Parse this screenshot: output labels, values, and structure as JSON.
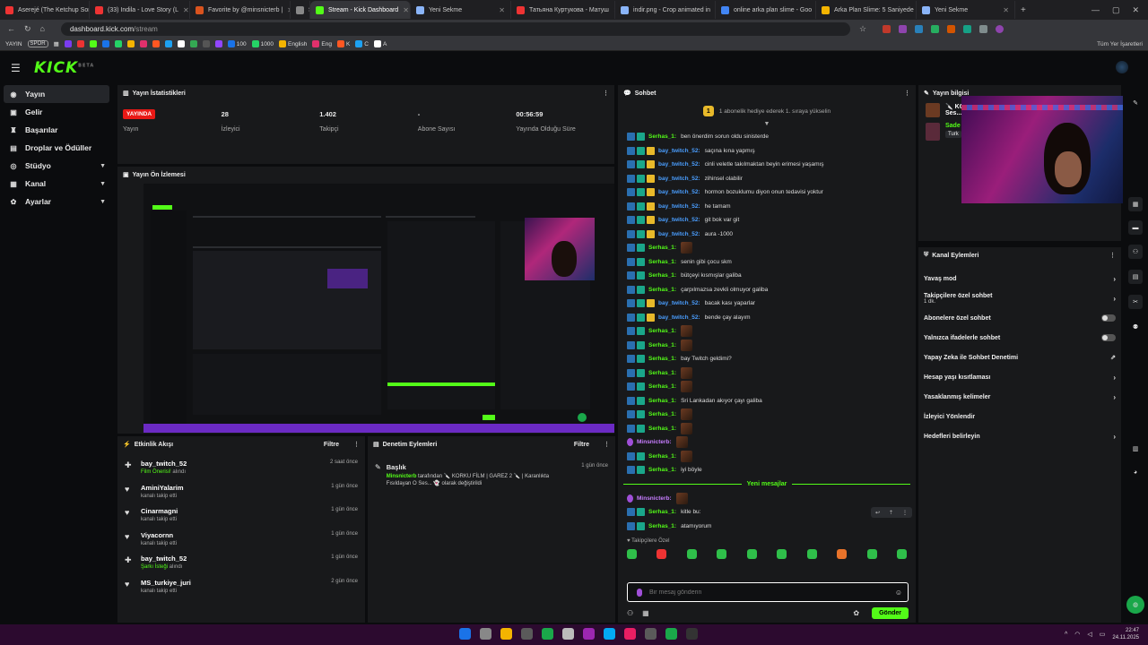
{
  "browser": {
    "tabs": [
      {
        "label": "Aserejé (The Ketchup Song)",
        "color": "#e33"
      },
      {
        "label": "(33) Indila - Love Story (L",
        "color": "#e33"
      },
      {
        "label": "Favorite by @minsnicterb |",
        "color": "#d9531e"
      },
      {
        "label": "SPOR",
        "color": "#888"
      },
      {
        "label": "Stream - Kick Dashboard",
        "color": "#53fc18"
      },
      {
        "label": "Yeni Sekme",
        "color": "#8ab4f8"
      },
      {
        "label": "Татьяна Куртукова - Матуш",
        "color": "#e33"
      },
      {
        "label": "indir.png - Crop animated in",
        "color": "#8ab4f8"
      },
      {
        "label": "online arka plan slime - Goo",
        "color": "#4285f4"
      },
      {
        "label": "Arka Plan Slime: 5 Saniyede",
        "color": "#f4b400"
      },
      {
        "label": "Yeni Sekme",
        "color": "#8ab4f8"
      }
    ],
    "url_host": "dashboard.kick.com",
    "url_path": "/stream",
    "bookmarks_left": [
      "YAYIN",
      "SPOR"
    ],
    "bookmarks_mid": [
      "100",
      "1000",
      "English",
      "Eng",
      "K",
      "C",
      "A"
    ],
    "bookmarks_right": "Tüm Yer İşaretleri"
  },
  "app": {
    "logo": "KICK",
    "logo_sup": "BETA"
  },
  "sidebar": {
    "items": [
      {
        "label": "Yayın",
        "icon": "broadcast-icon",
        "glyph": "◉"
      },
      {
        "label": "Gelir",
        "icon": "wallet-icon",
        "glyph": "▣"
      },
      {
        "label": "Başarılar",
        "icon": "trophy-icon",
        "glyph": "♜"
      },
      {
        "label": "Droplar ve Ödüller",
        "icon": "gift-icon",
        "glyph": "▤"
      },
      {
        "label": "Stüdyo",
        "icon": "studio-icon",
        "glyph": "◎"
      },
      {
        "label": "Kanal",
        "icon": "channel-icon",
        "glyph": "▦"
      },
      {
        "label": "Ayarlar",
        "icon": "gear-icon",
        "glyph": "✿"
      }
    ]
  },
  "stats_panel": {
    "title": "Yayın İstatistikleri",
    "live_badge": "YAYINDA",
    "stats": [
      {
        "value": "",
        "label": "Yayın"
      },
      {
        "value": "28",
        "label": "İzleyici"
      },
      {
        "value": "1.402",
        "label": "Takipçi"
      },
      {
        "value": "-",
        "label": "Abone Sayısı"
      },
      {
        "value": "00:56:59",
        "label": "Yayında Olduğu Süre"
      }
    ]
  },
  "preview_panel": {
    "title": "Yayın Ön İzlemesi"
  },
  "activity_panel": {
    "title": "Etkinlik Akışı",
    "filter": "Filtre",
    "items": [
      {
        "name": "bay_twitch_52",
        "highlight": "Film Önerisi!",
        "desc": " alındı",
        "time": "2 saat önce",
        "icon": "gift-icon",
        "glyph": "✚"
      },
      {
        "name": "AminiYalarim",
        "highlight": "",
        "desc": "kanalı takip etti",
        "time": "1 gün önce",
        "icon": "heart-icon",
        "glyph": "♥"
      },
      {
        "name": "Cinarmagni",
        "highlight": "",
        "desc": "kanalı takip etti",
        "time": "1 gün önce",
        "icon": "heart-icon",
        "glyph": "♥"
      },
      {
        "name": "Viyacornn",
        "highlight": "",
        "desc": "kanalı takip etti",
        "time": "1 gün önce",
        "icon": "heart-icon",
        "glyph": "♥"
      },
      {
        "name": "bay_twitch_52",
        "highlight": "Şarkı İsteği",
        "desc": " alındı",
        "time": "1 gün önce",
        "icon": "gift-icon",
        "glyph": "✚"
      },
      {
        "name": "MS_turkiye_juri",
        "highlight": "",
        "desc": "kanalı takip etti",
        "time": "2 gün önce",
        "icon": "heart-icon",
        "glyph": "♥"
      }
    ]
  },
  "mod_panel": {
    "title": "Denetim Eylemleri",
    "filter": "Filtre",
    "items": [
      {
        "name": "Başlık",
        "actor": "Minsnicterb",
        "desc": " tarafından 🔪 KORKU FİLM | GAREZ 2 🔪 | Karanlıkta Fısıldayan O Ses... 👻 olarak değiştirildi",
        "time": "1 gün önce"
      }
    ]
  },
  "chat_panel": {
    "title": "Sohbet",
    "sub_banner": "1 abonelik hediye ederek 1. sıraya yükselin",
    "messages": [
      {
        "user": "Serhas_1:",
        "color": "green",
        "badges": [
          "blue",
          "teal"
        ],
        "text": "ben önerdim sorun oldu sinisterde",
        "emote": false
      },
      {
        "user": "bay_twitch_52:",
        "color": "blue",
        "badges": [
          "blue",
          "teal",
          "crown"
        ],
        "text": "saçına kına yapmış",
        "emote": false
      },
      {
        "user": "bay_twitch_52:",
        "color": "blue",
        "badges": [
          "blue",
          "teal",
          "crown"
        ],
        "text": "cinli veletle takılmaktan beyin erimesi yaşamış",
        "emote": false
      },
      {
        "user": "bay_twitch_52:",
        "color": "blue",
        "badges": [
          "blue",
          "teal",
          "crown"
        ],
        "text": "zihinsel olabilir",
        "emote": false
      },
      {
        "user": "bay_twitch_52:",
        "color": "blue",
        "badges": [
          "blue",
          "teal",
          "crown"
        ],
        "text": "hormon bozuklumu diyon onun tedavisi yoktur",
        "emote": false
      },
      {
        "user": "bay_twitch_52:",
        "color": "blue",
        "badges": [
          "blue",
          "teal",
          "crown"
        ],
        "text": "he tamam",
        "emote": false
      },
      {
        "user": "bay_twitch_52:",
        "color": "blue",
        "badges": [
          "blue",
          "teal",
          "crown"
        ],
        "text": "git bok var git",
        "emote": false
      },
      {
        "user": "bay_twitch_52:",
        "color": "blue",
        "badges": [
          "blue",
          "teal",
          "crown"
        ],
        "text": "aura -1000",
        "emote": false
      },
      {
        "user": "Serhas_1:",
        "color": "green",
        "badges": [
          "blue",
          "teal"
        ],
        "text": "",
        "emote": true
      },
      {
        "user": "Serhas_1:",
        "color": "green",
        "badges": [
          "blue",
          "teal"
        ],
        "text": "senin gibi çocu skm",
        "emote": false
      },
      {
        "user": "Serhas_1:",
        "color": "green",
        "badges": [
          "blue",
          "teal"
        ],
        "text": "bütçeyi kısmışlar galiba",
        "emote": false
      },
      {
        "user": "Serhas_1:",
        "color": "green",
        "badges": [
          "blue",
          "teal"
        ],
        "text": "çarpılmazsa zevkli olmuyor galiba",
        "emote": false
      },
      {
        "user": "bay_twitch_52:",
        "color": "blue",
        "badges": [
          "blue",
          "teal",
          "crown"
        ],
        "text": "bacak kası yaparlar",
        "emote": false
      },
      {
        "user": "bay_twitch_52:",
        "color": "blue",
        "badges": [
          "blue",
          "teal",
          "crown"
        ],
        "text": "bende çay alayım",
        "emote": false
      },
      {
        "user": "Serhas_1:",
        "color": "green",
        "badges": [
          "blue",
          "teal"
        ],
        "text": "",
        "emote": true
      },
      {
        "user": "Serhas_1:",
        "color": "green",
        "badges": [
          "blue",
          "teal"
        ],
        "text": "",
        "emote": true
      },
      {
        "user": "Serhas_1:",
        "color": "green",
        "badges": [
          "blue",
          "teal"
        ],
        "text": "bay Twitch geldimi?",
        "emote": false
      },
      {
        "user": "Serhas_1:",
        "color": "green",
        "badges": [
          "blue",
          "teal"
        ],
        "text": "",
        "emote": true
      },
      {
        "user": "Serhas_1:",
        "color": "green",
        "badges": [
          "blue",
          "teal"
        ],
        "text": "",
        "emote": true
      },
      {
        "user": "Serhas_1:",
        "color": "green",
        "badges": [
          "blue",
          "teal"
        ],
        "text": "Sri Lankadan akıyor çayı galiba",
        "emote": false
      },
      {
        "user": "Serhas_1:",
        "color": "green",
        "badges": [
          "blue",
          "teal"
        ],
        "text": "",
        "emote": true
      },
      {
        "user": "Serhas_1:",
        "color": "green",
        "badges": [
          "blue",
          "teal"
        ],
        "text": "",
        "emote": true
      },
      {
        "user": "Minsnicterb:",
        "color": "purple",
        "badges": [
          "mic"
        ],
        "text": "",
        "emote": true
      },
      {
        "user": "Serhas_1:",
        "color": "green",
        "badges": [
          "blue",
          "teal"
        ],
        "text": "",
        "emote": true
      },
      {
        "user": "Serhas_1:",
        "color": "green",
        "badges": [
          "blue",
          "teal"
        ],
        "text": "iyi böyle",
        "emote": false
      }
    ],
    "new_messages_label": "Yeni mesajlar",
    "new_messages": [
      {
        "user": "Minsnicterb:",
        "color": "purple",
        "badges": [
          "mic"
        ],
        "text": "",
        "emote": true
      },
      {
        "user": "Serhas_1:",
        "color": "green",
        "badges": [
          "blue",
          "teal"
        ],
        "text": "kitle bu:",
        "emote": false
      },
      {
        "user": "Serhas_1:",
        "color": "green",
        "badges": [
          "blue",
          "teal"
        ],
        "text": "atamıyorum",
        "emote": false
      }
    ],
    "emote_label": "♥ Takipçilere Özel",
    "input_placeholder": "Bir mesaj gönderin",
    "send_label": "Gönder"
  },
  "info_panel": {
    "title": "Yayın bilgisi",
    "stream_title_fragment": "🔪 KOR",
    "stream_title_fragment2": "Ses...",
    "category_fragment": "Sade",
    "tag_fragment": "Turk"
  },
  "channel_actions": {
    "title": "Kanal Eylemleri",
    "items": [
      {
        "label": "Yavaş mod",
        "sub": "",
        "control": "chevron"
      },
      {
        "label": "Takipçilere özel sohbet",
        "sub": "1 dk.",
        "control": "chevron"
      },
      {
        "label": "Abonelere özel sohbet",
        "sub": "",
        "control": "toggle"
      },
      {
        "label": "Yalnızca ifadelerle sohbet",
        "sub": "",
        "control": "toggle"
      },
      {
        "label": "Yapay Zeka ile Sohbet Denetimi",
        "sub": "",
        "control": "external"
      },
      {
        "label": "Hesap yaşı kısıtlaması",
        "sub": "",
        "control": "chevron"
      },
      {
        "label": "Yasaklanmış kelimeler",
        "sub": "",
        "control": "chevron"
      },
      {
        "label": "İzleyici Yönlendir",
        "sub": "",
        "control": "none"
      },
      {
        "label": "Hedefleri belirleyin",
        "sub": "",
        "control": "chevron"
      }
    ]
  },
  "taskbar": {
    "time": "22:47",
    "date": "24.11.2025"
  }
}
